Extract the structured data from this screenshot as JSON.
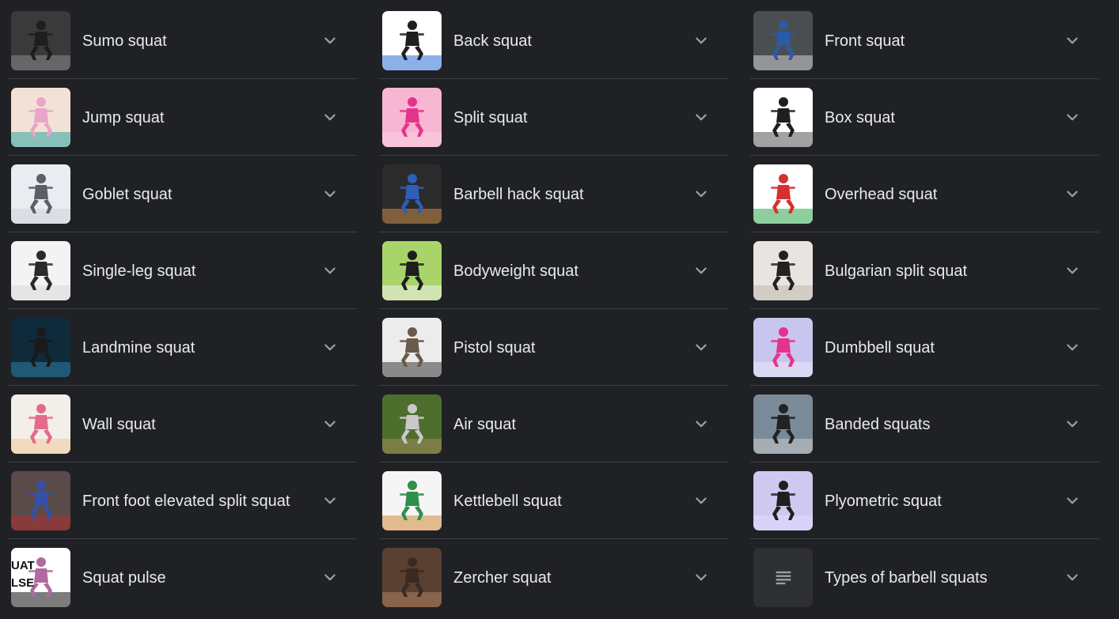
{
  "columns": [
    {
      "items": [
        {
          "label": "Sumo squat",
          "thumb": {
            "bg": "#3a3a3a",
            "fig": "#1e1e1e",
            "accent": "#8a8a8a"
          }
        },
        {
          "label": "Jump squat",
          "thumb": {
            "bg": "#f4e1d6",
            "fig": "#e8a6c8",
            "accent": "#2aa7a1"
          }
        },
        {
          "label": "Goblet squat",
          "thumb": {
            "bg": "#e9edf1",
            "fig": "#5b5f66",
            "accent": "#cfd4da"
          }
        },
        {
          "label": "Single-leg squat",
          "thumb": {
            "bg": "#f3f3f3",
            "fig": "#2a2a2a",
            "accent": "#d9d9d9"
          }
        },
        {
          "label": "Landmine squat",
          "thumb": {
            "bg": "#0f2a3a",
            "fig": "#1a1a1a",
            "accent": "#2f7fa8"
          }
        },
        {
          "label": "Wall squat",
          "thumb": {
            "bg": "#f2efe9",
            "fig": "#e46a8a",
            "accent": "#f0c99a"
          }
        },
        {
          "label": "Front foot elevated split squat",
          "thumb": {
            "bg": "#5a4a4a",
            "fig": "#3550a8",
            "accent": "#b03030"
          }
        },
        {
          "label": "Squat pulse",
          "thumb": {
            "bg": "#ffffff",
            "fig": "#b06aa0",
            "accent": "#111111",
            "text": "UAT\nLSE"
          }
        }
      ]
    },
    {
      "items": [
        {
          "label": "Back squat",
          "thumb": {
            "bg": "#ffffff",
            "fig": "#1f1f1f",
            "accent": "#2d6fd6"
          }
        },
        {
          "label": "Split squat",
          "thumb": {
            "bg": "#f7b6d2",
            "fig": "#e4338a",
            "accent": "#f9d0e3"
          }
        },
        {
          "label": "Barbell hack squat",
          "thumb": {
            "bg": "#2b2b2b",
            "fig": "#2d5fb8",
            "accent": "#c58a4a"
          }
        },
        {
          "label": "Bodyweight squat",
          "thumb": {
            "bg": "#a9d46a",
            "fig": "#1e1e1e",
            "accent": "#f1f1f1"
          }
        },
        {
          "label": "Pistol squat",
          "thumb": {
            "bg": "#ececec",
            "fig": "#6a5a48",
            "accent": "#3a3a3a"
          }
        },
        {
          "label": "Air squat",
          "thumb": {
            "bg": "#4e6e2e",
            "fig": "#c9c9c9",
            "accent": "#a08a5a"
          }
        },
        {
          "label": "Kettlebell squat",
          "thumb": {
            "bg": "#f5f5f5",
            "fig": "#2f8f4a",
            "accent": "#d08a3a"
          }
        },
        {
          "label": "Zercher squat",
          "thumb": {
            "bg": "#5a4030",
            "fig": "#3a2a22",
            "accent": "#b08060"
          }
        }
      ]
    },
    {
      "items": [
        {
          "label": "Front squat",
          "thumb": {
            "bg": "#4a4e52",
            "fig": "#2b5aa8",
            "accent": "#d0d0d0"
          }
        },
        {
          "label": "Box squat",
          "thumb": {
            "bg": "#ffffff",
            "fig": "#1f1f1f",
            "accent": "#555555"
          }
        },
        {
          "label": "Overhead squat",
          "thumb": {
            "bg": "#ffffff",
            "fig": "#d43030",
            "accent": "#2ea84a"
          }
        },
        {
          "label": "Bulgarian split squat",
          "thumb": {
            "bg": "#e8e4df",
            "fig": "#222222",
            "accent": "#bfb8ae"
          }
        },
        {
          "label": "Dumbbell squat",
          "thumb": {
            "bg": "#c8c6ee",
            "fig": "#e4338a",
            "accent": "#e9e8f7"
          }
        },
        {
          "label": "Banded squats",
          "thumb": {
            "bg": "#7b8a99",
            "fig": "#222222",
            "accent": "#c9c9c9"
          }
        },
        {
          "label": "Plyometric squat",
          "thumb": {
            "bg": "#cfc8f1",
            "fig": "#1f1f1f",
            "accent": "#e2dcff"
          }
        },
        {
          "label": "Types of barbell squats",
          "thumb": {
            "icon": "document-lines-icon"
          }
        }
      ]
    }
  ],
  "chevron_icon": "chevron-down-icon",
  "colors": {
    "background": "#202124",
    "text": "#e8eaed",
    "divider": "#3c4043",
    "chevron": "#9aa0a6"
  }
}
